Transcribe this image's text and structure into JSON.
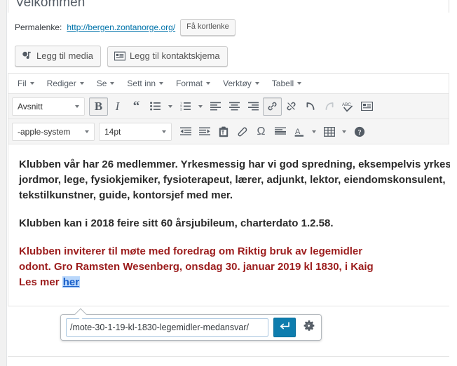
{
  "post_title": "Velkommen",
  "permalink": {
    "label": "Permalenke:",
    "url": "http://bergen.zontanorge.org/",
    "shortlink_button": "Få kortlenke"
  },
  "media_buttons": [
    {
      "label": "Legg til media",
      "icon": "media-icon"
    },
    {
      "label": "Legg til kontaktskjema",
      "icon": "contact-form-icon"
    }
  ],
  "menubar": [
    {
      "label": "Fil"
    },
    {
      "label": "Rediger"
    },
    {
      "label": "Se"
    },
    {
      "label": "Sett inn"
    },
    {
      "label": "Format"
    },
    {
      "label": "Verktøy"
    },
    {
      "label": "Tabell"
    }
  ],
  "toolbar_row1": {
    "paragraph_select": "Avsnitt",
    "buttons": [
      {
        "name": "bold-button",
        "label": "B",
        "state": "active"
      },
      {
        "name": "italic-button",
        "label": "I",
        "state": "normal"
      },
      {
        "name": "blockquote-button",
        "label": "“",
        "state": "normal"
      },
      {
        "name": "bullet-list-button",
        "label": "bullist-icon",
        "state": "normal"
      },
      {
        "name": "numbered-list-button",
        "label": "numlist-icon",
        "state": "normal"
      },
      {
        "name": "align-left-button",
        "label": "align-left-icon",
        "state": "normal"
      },
      {
        "name": "align-center-button",
        "label": "align-center-icon",
        "state": "normal"
      },
      {
        "name": "align-right-button",
        "label": "align-right-icon",
        "state": "normal"
      },
      {
        "name": "insert-link-button",
        "label": "link-icon",
        "state": "active"
      },
      {
        "name": "remove-link-button",
        "label": "unlink-icon",
        "state": "normal"
      },
      {
        "name": "undo-button",
        "label": "undo-icon",
        "state": "normal"
      },
      {
        "name": "redo-button",
        "label": "redo-icon",
        "state": "disabled"
      },
      {
        "name": "spellcheck-button",
        "label": "ABC",
        "state": "normal"
      },
      {
        "name": "read-more-button",
        "label": "read-more-icon",
        "state": "normal"
      }
    ]
  },
  "toolbar_row2": {
    "font_select": "-apple-system",
    "size_select": "14pt",
    "buttons": [
      {
        "name": "outdent-button",
        "label": "outdent-icon"
      },
      {
        "name": "indent-button",
        "label": "indent-icon"
      },
      {
        "name": "paste-as-text-button",
        "label": "clipboard-icon"
      },
      {
        "name": "clear-formatting-button",
        "label": "eraser-icon"
      },
      {
        "name": "special-character-button",
        "label": "Ω"
      },
      {
        "name": "horizontal-rule-button",
        "label": "horizontal-rule-icon"
      },
      {
        "name": "text-color-button",
        "label": "A"
      },
      {
        "name": "table-button",
        "label": "table-icon"
      },
      {
        "name": "help-button",
        "label": "help-icon"
      }
    ]
  },
  "content": {
    "paragraph1": "Klubben vår har 26 medlemmer. Yrkesmessig har vi god spredning, eksempelvis yrkesaktive jordmor, lege, fysiokjemiker, fysioterapeut, lærer, adjunkt, lektor, eiendomskonsulent, tekstilkunstner, guide, kontorsjef med mer.",
    "paragraph2": "Klubben kan i 2018 feire sitt 60 årsjubileum, charterdato 1.2.58.",
    "paragraph3_line1": "Klubben inviterer til møte med foredrag om Riktig bruk av legemidler",
    "paragraph3_line2": "odont. Gro Ramsten Wesenberg, onsdag 30. januar 2019 kl 1830, i Kaig",
    "paragraph4_prefix": "Les mer ",
    "paragraph4_link": "her"
  },
  "link_popup": {
    "url_value": "/mote-30-1-19-kl-1830-legemidler-medansvar/",
    "apply_icon": "enter-arrow-icon",
    "settings_icon": "gear-icon"
  },
  "colors": {
    "red_text": "#9c1d1d",
    "link_blue": "#0073aa",
    "selection_blue": "#b9d7fb",
    "apply_button": "#0e7dae"
  }
}
